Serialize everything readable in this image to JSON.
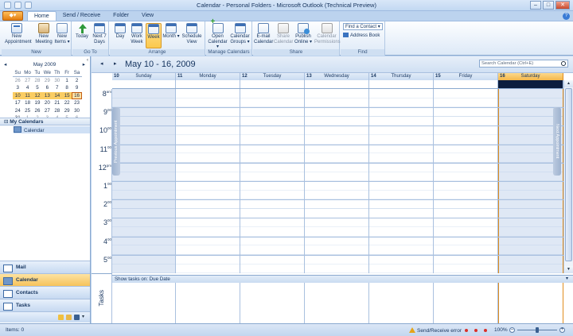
{
  "window": {
    "title": "Calendar - Personal Folders - Microsoft Outlook (Technical Preview)",
    "ctrl_min": "–",
    "ctrl_max": "□",
    "ctrl_close": "✕"
  },
  "office_button": {
    "label": "◆▾"
  },
  "tabs": [
    {
      "label": "Home"
    },
    {
      "label": "Send / Receive"
    },
    {
      "label": "Folder"
    },
    {
      "label": "View"
    }
  ],
  "ribbon": {
    "groups": {
      "new": "New",
      "goto": "Go To",
      "arrange": "Arrange",
      "manage": "Manage Calendars",
      "share": "Share",
      "find": "Find"
    },
    "new_appointment": "New Appointment",
    "new_meeting": "New Meeting",
    "new_items": "New Items ▾",
    "today": "Today",
    "next7": "Next 7 Days",
    "day": "Day",
    "work_week": "Work Week",
    "week": "Week",
    "month": "Month ▾",
    "schedule_view": "Schedule View",
    "open_calendar": "Open Calendar ▾",
    "calendar_groups": "Calendar Groups ▾",
    "email_calendar": "E-mail Calendar",
    "share_calendar": "Share Calendar",
    "publish_online": "Publish Online ▾",
    "calendar_permissions": "Calendar Permissions",
    "find_contact": "Find a Contact ▾",
    "address_book": "Address Book"
  },
  "minical": {
    "month": "May 2009",
    "prev": "◂",
    "next": "▸",
    "dow": [
      "Su",
      "Mo",
      "Tu",
      "We",
      "Th",
      "Fr",
      "Sa"
    ],
    "weeks": [
      [
        {
          "d": "26",
          "o": 1
        },
        {
          "d": "27",
          "o": 1
        },
        {
          "d": "28",
          "o": 1
        },
        {
          "d": "29",
          "o": 1
        },
        {
          "d": "30",
          "o": 1
        },
        {
          "d": "1"
        },
        {
          "d": "2"
        }
      ],
      [
        {
          "d": "3"
        },
        {
          "d": "4"
        },
        {
          "d": "5"
        },
        {
          "d": "6"
        },
        {
          "d": "7"
        },
        {
          "d": "8"
        },
        {
          "d": "9"
        }
      ],
      [
        {
          "d": "10",
          "s": 1
        },
        {
          "d": "11",
          "s": 1
        },
        {
          "d": "12",
          "s": 1
        },
        {
          "d": "13",
          "s": 1
        },
        {
          "d": "14",
          "s": 1
        },
        {
          "d": "15",
          "s": 1
        },
        {
          "d": "16",
          "s": 1,
          "t": 1
        }
      ],
      [
        {
          "d": "17"
        },
        {
          "d": "18"
        },
        {
          "d": "19"
        },
        {
          "d": "20"
        },
        {
          "d": "21"
        },
        {
          "d": "22"
        },
        {
          "d": "23"
        }
      ],
      [
        {
          "d": "24"
        },
        {
          "d": "25"
        },
        {
          "d": "26"
        },
        {
          "d": "27"
        },
        {
          "d": "28"
        },
        {
          "d": "29"
        },
        {
          "d": "30"
        }
      ],
      [
        {
          "d": "31"
        },
        {
          "d": "1",
          "o": 1
        },
        {
          "d": "2",
          "o": 1
        },
        {
          "d": "3",
          "o": 1
        },
        {
          "d": "4",
          "o": 1
        },
        {
          "d": "5",
          "o": 1
        },
        {
          "d": "6",
          "o": 1
        }
      ]
    ]
  },
  "my_calendars": {
    "header": "My Calendars",
    "items": [
      "Calendar"
    ]
  },
  "nav_buttons": [
    "Mail",
    "Calendar",
    "Contacts",
    "Tasks"
  ],
  "calendar": {
    "prev": "◂",
    "next": "▸",
    "date_range": "May 10 - 16, 2009",
    "search_placeholder": "Search Calendar (Ctrl+E)",
    "days": [
      {
        "num": "10",
        "name": "Sunday"
      },
      {
        "num": "11",
        "name": "Monday"
      },
      {
        "num": "12",
        "name": "Tuesday"
      },
      {
        "num": "13",
        "name": "Wednesday"
      },
      {
        "num": "14",
        "name": "Thursday"
      },
      {
        "num": "15",
        "name": "Friday"
      },
      {
        "num": "16",
        "name": "Saturday"
      }
    ],
    "hours": [
      {
        "h": "8",
        "m": "am"
      },
      {
        "h": "9",
        "m": "00"
      },
      {
        "h": "10",
        "m": "00"
      },
      {
        "h": "11",
        "m": "00"
      },
      {
        "h": "12",
        "m": "pm"
      },
      {
        "h": "1",
        "m": "00"
      },
      {
        "h": "2",
        "m": "00"
      },
      {
        "h": "3",
        "m": "00"
      },
      {
        "h": "4",
        "m": "00"
      },
      {
        "h": "5",
        "m": "00"
      }
    ],
    "prev_appointment": "Previous Appointment",
    "next_appointment": "Next Appointment",
    "tasks_show": "Show tasks on: Due Date",
    "tasks_label": "Tasks",
    "scroll_up": "▲",
    "scroll_down": "▼",
    "tasks_chevron": "▾"
  },
  "statusbar": {
    "items": "Items: 0",
    "error": "Send/Receive error",
    "zoom": "100%",
    "zoom_level": 0.5,
    "zoom_minus": "–",
    "zoom_plus": "+"
  }
}
